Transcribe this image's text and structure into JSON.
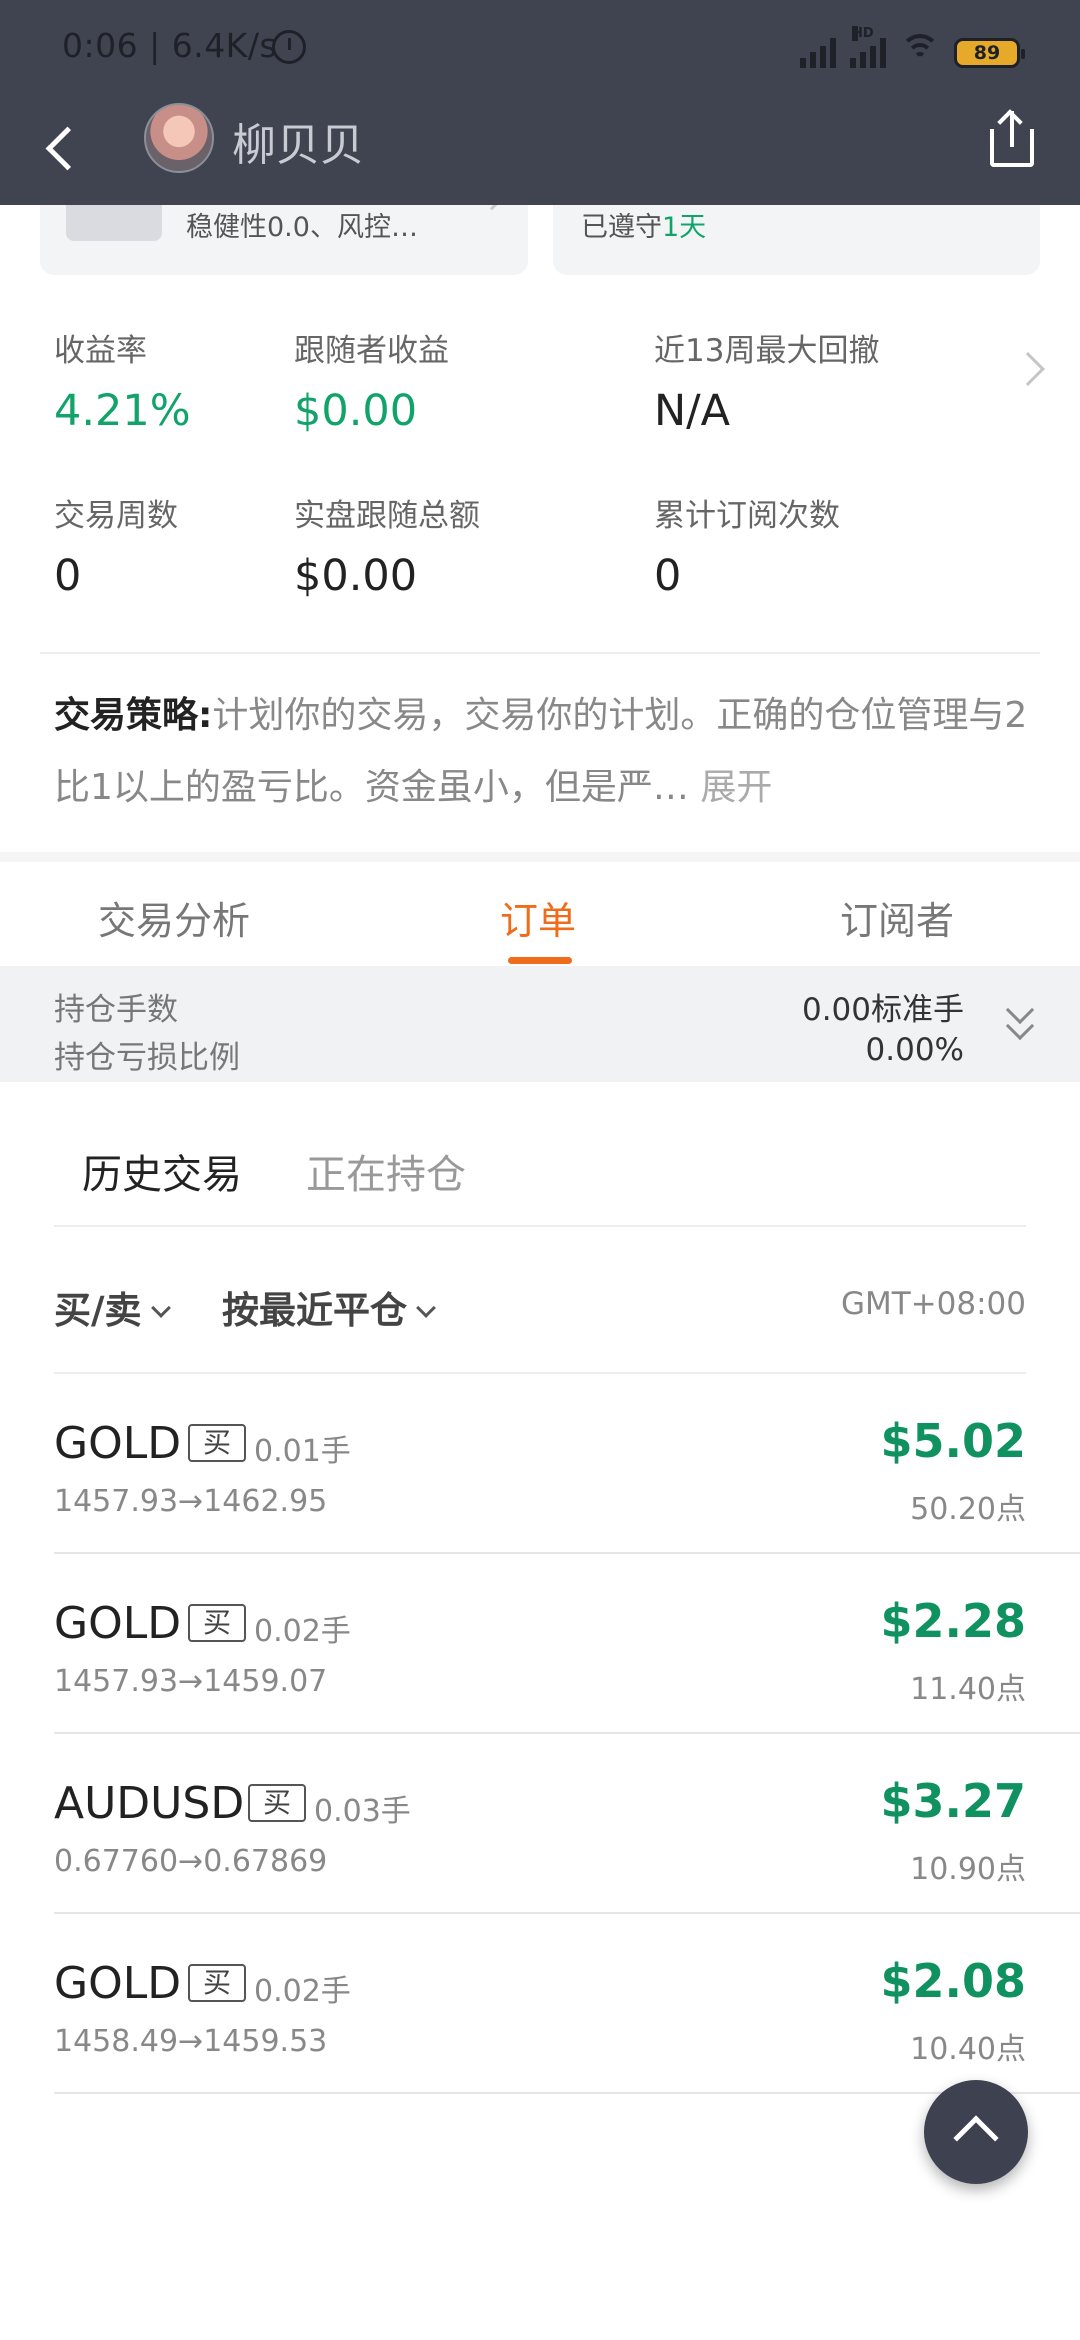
{
  "status_bar": {
    "time": "0:06 | 6.4K/s",
    "hd": "HD",
    "battery": "89"
  },
  "nav": {
    "title": "柳贝贝"
  },
  "cards": {
    "left_text": "稳健性0.0、风控…",
    "right_prefix": "已遵守",
    "right_value": "1天"
  },
  "stats": [
    {
      "label": "收益率",
      "value": "4.21%",
      "green": true
    },
    {
      "label": "跟随者收益",
      "value": "$0.00",
      "green": true
    },
    {
      "label": "近13周最大回撤",
      "value": "N/A",
      "green": false
    },
    {
      "label": "交易周数",
      "value": "0",
      "green": false
    },
    {
      "label": "实盘跟随总额",
      "value": "$0.00",
      "green": false
    },
    {
      "label": "累计订阅次数",
      "value": "0",
      "green": false
    }
  ],
  "strategy": {
    "label": "交易策略:",
    "text": "计划你的交易，交易你的计划。正确的仓位管理与2比1以上的盈亏比。资金虽小，但是严…",
    "expand": "展开"
  },
  "tabs": [
    {
      "label": "交易分析"
    },
    {
      "label": "订单"
    },
    {
      "label": "订阅者"
    }
  ],
  "position_summary": {
    "lots_label": "持仓手数",
    "lots_value": "0.00标准手",
    "pnl_label": "持仓亏损比例",
    "pnl_value": "0.00%"
  },
  "subtabs": [
    {
      "label": "历史交易"
    },
    {
      "label": "正在持仓"
    }
  ],
  "filters": {
    "side": "买/卖",
    "sort": "按最近平仓",
    "timezone": "GMT+08:00"
  },
  "trades": [
    {
      "symbol": "GOLD",
      "side": "买",
      "lot": "0.01手",
      "prices": "1457.93→1462.95",
      "profit": "$5.02",
      "points": "50.20点"
    },
    {
      "symbol": "GOLD",
      "side": "买",
      "lot": "0.02手",
      "prices": "1457.93→1459.07",
      "profit": "$2.28",
      "points": "11.40点"
    },
    {
      "symbol": "AUDUSD",
      "side": "买",
      "lot": "0.03手",
      "prices": "0.67760→0.67869",
      "profit": "$3.27",
      "points": "10.90点"
    },
    {
      "symbol": "GOLD",
      "side": "买",
      "lot": "0.02手",
      "prices": "1458.49→1459.53",
      "profit": "$2.08",
      "points": "10.40点"
    }
  ],
  "colors": {
    "header_bg": "#3f4450",
    "accent": "#ee6c1a",
    "profit_green": "#0f9160"
  },
  "icons": [
    "back-arrow-icon",
    "share-icon",
    "alarm-icon",
    "signal-icon",
    "wifi-icon",
    "battery-icon",
    "chevron-right-icon",
    "double-chevron-down-icon",
    "caret-down-icon",
    "chevron-up-icon"
  ]
}
